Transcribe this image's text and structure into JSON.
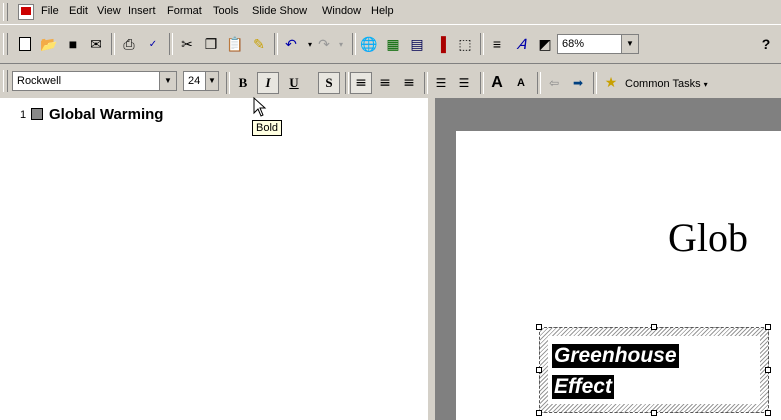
{
  "menubar": {
    "items": [
      "File",
      "Edit",
      "View",
      "Insert",
      "Format",
      "Tools",
      "Slide Show",
      "Window",
      "Help"
    ]
  },
  "toolbar": {
    "zoom_value": "68%",
    "help_glyph": "?"
  },
  "formatting": {
    "font_name": "Rockwell",
    "font_size": "24",
    "bold_label": "B",
    "italic_label": "I",
    "underline_label": "U",
    "shadow_label": "S",
    "increase_font_label": "A",
    "decrease_font_label": "A",
    "common_tasks_label": "Common Tasks"
  },
  "tooltip": {
    "text": "Bold"
  },
  "outline": {
    "slide_number": "1",
    "slide_title": "Global Warming"
  },
  "slide": {
    "title_visible": "Glob",
    "textbox_line1": "Greenhouse",
    "textbox_line2": "Effect"
  }
}
